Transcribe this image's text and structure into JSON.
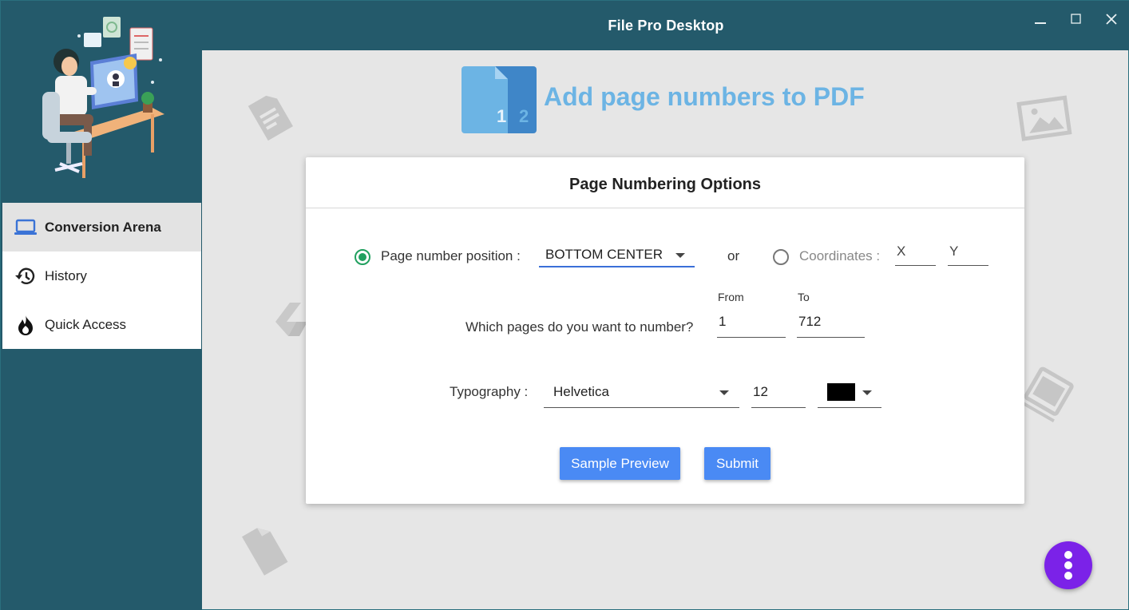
{
  "window": {
    "title": "File Pro Desktop",
    "controls": [
      "minimize",
      "maximize",
      "close"
    ]
  },
  "sidebar": {
    "items": [
      {
        "label": "Conversion Arena",
        "icon": "laptop-icon",
        "active": true
      },
      {
        "label": "History",
        "icon": "history-icon",
        "active": false
      },
      {
        "label": "Quick Access",
        "icon": "flame-icon",
        "active": false
      }
    ]
  },
  "hero": {
    "title": "Add page numbers to PDF",
    "icon_digits": [
      "1",
      "2"
    ]
  },
  "card": {
    "title": "Page Numbering Options",
    "position_label": "Page number position :",
    "position_value": "BOTTOM CENTER",
    "or_label": "or",
    "coordinates_label": "Coordinates :",
    "x_placeholder": "X",
    "y_placeholder": "Y",
    "pages_label": "Which pages do you want to number?",
    "from_label": "From",
    "to_label": "To",
    "from_value": "1",
    "to_value": "712",
    "typography_label": "Typography :",
    "font_value": "Helvetica",
    "size_value": "12",
    "color_value": "#000000",
    "preview_button": "Sample Preview",
    "submit_button": "Submit"
  },
  "colors": {
    "titlebar": "#245a6b",
    "accent_blue": "#4a8af4",
    "hero_text": "#6cb4e4",
    "radio_green": "#21a05f",
    "fab_purple": "#7b22e8"
  }
}
